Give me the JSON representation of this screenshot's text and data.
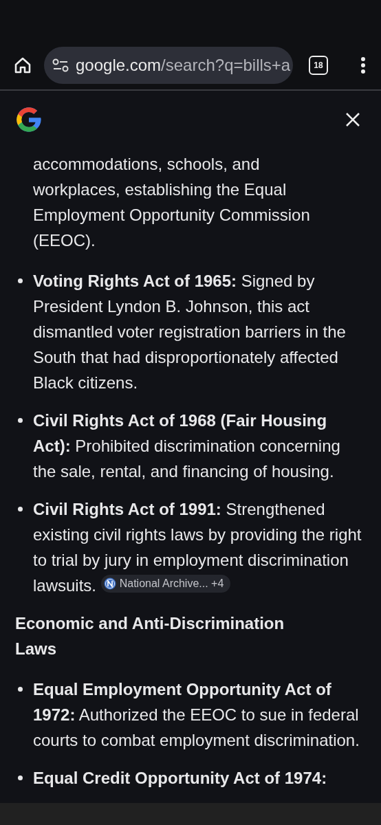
{
  "toolbar": {
    "url_host": "google.com",
    "url_path": "/search?q=bills+a",
    "tab_count": "18"
  },
  "panel": {
    "blocks": [
      {
        "kind": "paragraph",
        "text": "accommodations, schools, and workplaces, establishing the Equal Employment Opportunity Commission (EEOC)."
      },
      {
        "kind": "list",
        "items": [
          {
            "text": "**Voting Rights Act of 1965:** Signed by President Lyndon B. Johnson, this act dismantled voter registration barriers in the South that had disproportionately affected Black citizens."
          },
          {
            "text": "**Civil Rights Act of 1968 (Fair Housing Act):** Prohibited discrimination concerning the sale, rental, and financing of housing."
          },
          {
            "text": "**Civil Rights Act of 1991:** Strengthened existing civil rights laws by providing the right to trial by jury in employment discrimination lawsuits.",
            "source_chip": {
              "label": "National Archive...",
              "count": "+4"
            }
          }
        ]
      },
      {
        "kind": "heading",
        "text": "Economic and Anti-Discrimination Laws"
      },
      {
        "kind": "list",
        "items": [
          {
            "text": "**Equal Employment Opportunity Act of 1972:** Authorized the EEOC to sue in federal courts to combat employment discrimination."
          },
          {
            "text": "**Equal Credit Opportunity Act of 1974:**"
          }
        ]
      }
    ]
  }
}
